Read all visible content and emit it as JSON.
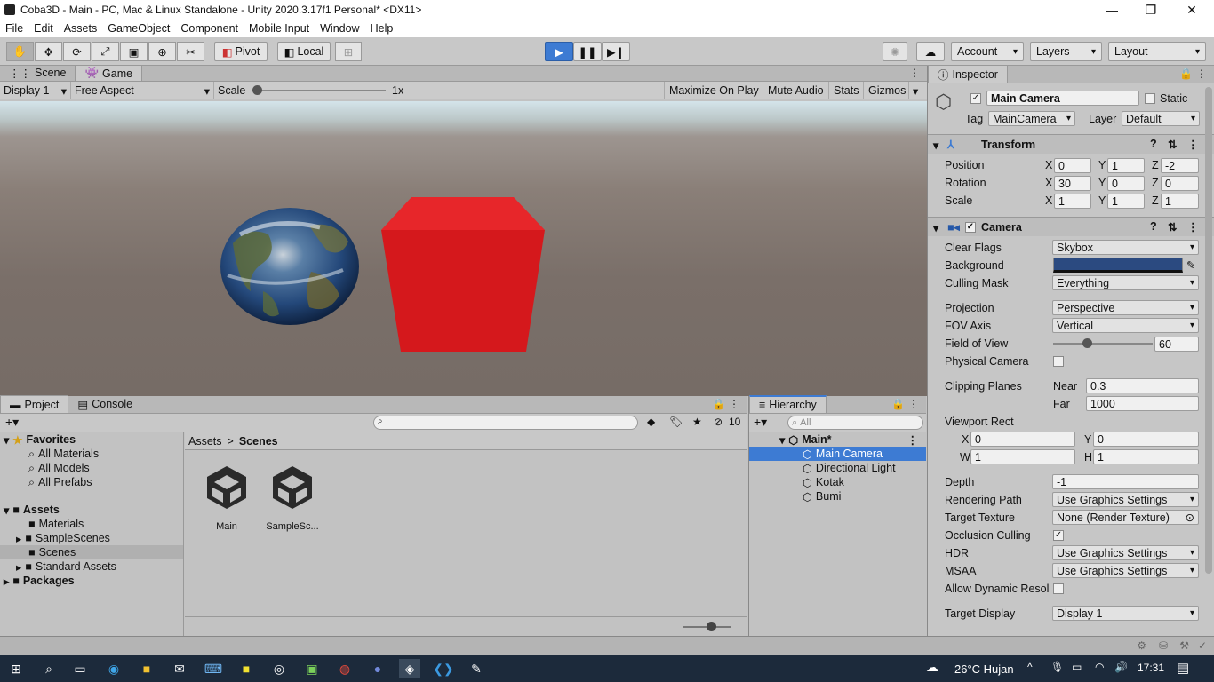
{
  "window": {
    "title": "Coba3D - Main - PC, Mac & Linux Standalone - Unity 2020.3.17f1 Personal* <DX11>",
    "minimize": "—",
    "maximize": "❐",
    "close": "✕"
  },
  "menu": [
    "File",
    "Edit",
    "Assets",
    "GameObject",
    "Component",
    "Mobile Input",
    "Window",
    "Help"
  ],
  "toolbar": {
    "pivot": "Pivot",
    "local": "Local",
    "account": "Account",
    "layers": "Layers",
    "layout": "Layout"
  },
  "game": {
    "tabs": [
      "Scene",
      "Game"
    ],
    "display": "Display 1",
    "aspect": "Free Aspect",
    "scale_label": "Scale",
    "scale_value": "1x",
    "maximize": "Maximize On Play",
    "mute": "Mute Audio",
    "stats": "Stats",
    "gizmos": "Gizmos"
  },
  "project": {
    "tabs": [
      "Project",
      "Console"
    ],
    "hidden_count": "10",
    "tree": [
      {
        "label": "Favorites",
        "bold": true
      },
      {
        "label": "All Materials"
      },
      {
        "label": "All Models"
      },
      {
        "label": "All Prefabs"
      },
      {
        "label": "Assets",
        "bold": true
      },
      {
        "label": "Materials"
      },
      {
        "label": "SampleScenes"
      },
      {
        "label": "Scenes"
      },
      {
        "label": "Standard Assets"
      },
      {
        "label": "Packages",
        "bold": true
      }
    ],
    "breadcrumb": [
      "Assets",
      "Scenes"
    ],
    "breadcrumb_sep": ">",
    "assets": [
      "Main",
      "SampleSc..."
    ]
  },
  "hierarchy": {
    "tab": "Hierarchy",
    "search_placeholder": "All",
    "scene": "Main*",
    "items": [
      "Main Camera",
      "Directional Light",
      "Kotak",
      "Bumi"
    ]
  },
  "inspector": {
    "tab": "Inspector",
    "name": "Main Camera",
    "static": "Static",
    "tag_label": "Tag",
    "tag": "MainCamera",
    "layer_label": "Layer",
    "layer": "Default",
    "transform": {
      "title": "Transform",
      "position_label": "Position",
      "rotation_label": "Rotation",
      "scale_label": "Scale",
      "position": [
        "0",
        "1",
        "-2"
      ],
      "rotation": [
        "30",
        "0",
        "0"
      ],
      "scale": [
        "1",
        "1",
        "1"
      ],
      "axes": [
        "X",
        "Y",
        "Z"
      ]
    },
    "camera": {
      "title": "Camera",
      "clear_flags_label": "Clear Flags",
      "clear_flags": "Skybox",
      "background_label": "Background",
      "background_color": "#2b4a80",
      "culling_mask_label": "Culling Mask",
      "culling_mask": "Everything",
      "projection_label": "Projection",
      "projection": "Perspective",
      "fov_axis_label": "FOV Axis",
      "fov_axis": "Vertical",
      "fov_label": "Field of View",
      "fov": "60",
      "physical_label": "Physical Camera",
      "clipping_label": "Clipping Planes",
      "near_label": "Near",
      "near": "0.3",
      "far_label": "Far",
      "far": "1000",
      "viewport_label": "Viewport Rect",
      "vx": "0",
      "vy": "0",
      "vw": "1",
      "vh": "1",
      "x_label": "X",
      "y_label": "Y",
      "w_label": "W",
      "h_label": "H",
      "depth_label": "Depth",
      "depth": "-1",
      "rendering_label": "Rendering Path",
      "rendering": "Use Graphics Settings",
      "target_texture_label": "Target Texture",
      "target_texture": "None (Render Texture)",
      "occlusion_label": "Occlusion Culling",
      "hdr_label": "HDR",
      "hdr": "Use Graphics Settings",
      "msaa_label": "MSAA",
      "msaa": "Use Graphics Settings",
      "dyn_label": "Allow Dynamic Resol",
      "target_display_label": "Target Display",
      "target_display": "Display 1"
    }
  },
  "taskbar": {
    "weather": "26°C  Hujan",
    "time": "17:31"
  }
}
